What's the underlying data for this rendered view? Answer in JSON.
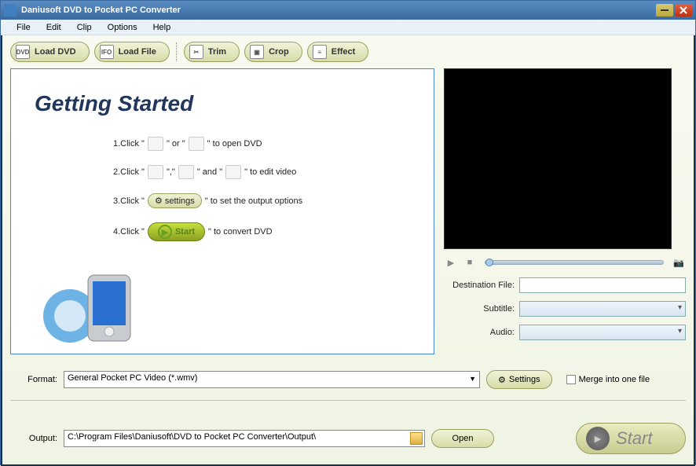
{
  "window": {
    "title": "Daniusoft DVD to Pocket PC Converter"
  },
  "menubar": [
    "File",
    "Edit",
    "Clip",
    "Options",
    "Help"
  ],
  "toolbar": {
    "load_dvd": "Load DVD",
    "load_file": "Load File",
    "trim": "Trim",
    "crop": "Crop",
    "effect": "Effect"
  },
  "getting_started": {
    "title": "Getting Started",
    "step1_a": "1.Click \"",
    "step1_b": "\" or \"",
    "step1_c": "\" to open DVD",
    "step2_a": "2.Click \"",
    "step2_b": "\",\"",
    "step2_c": "\" and \"",
    "step2_d": "\" to edit video",
    "step3_a": "3.Click \"",
    "step3_b": "\" to set the output options",
    "step3_settings": "settings",
    "step4_a": "4.Click \"",
    "step4_b": "\" to convert DVD",
    "step4_start": "Start"
  },
  "right": {
    "dest_label": "Destination File:",
    "subtitle_label": "Subtitle:",
    "audio_label": "Audio:",
    "dest_value": "",
    "subtitle_value": "",
    "audio_value": ""
  },
  "format": {
    "label": "Format:",
    "value": "General Pocket PC Video (*.wmv)",
    "settings_btn": "Settings",
    "merge_label": "Merge into one file"
  },
  "output": {
    "label": "Output:",
    "value": "C:\\Program Files\\Daniusoft\\DVD to Pocket PC Converter\\Output\\",
    "open_btn": "Open",
    "start_btn": "Start"
  },
  "icons": {
    "dvd": "DVD",
    "ifo": "IFO"
  }
}
